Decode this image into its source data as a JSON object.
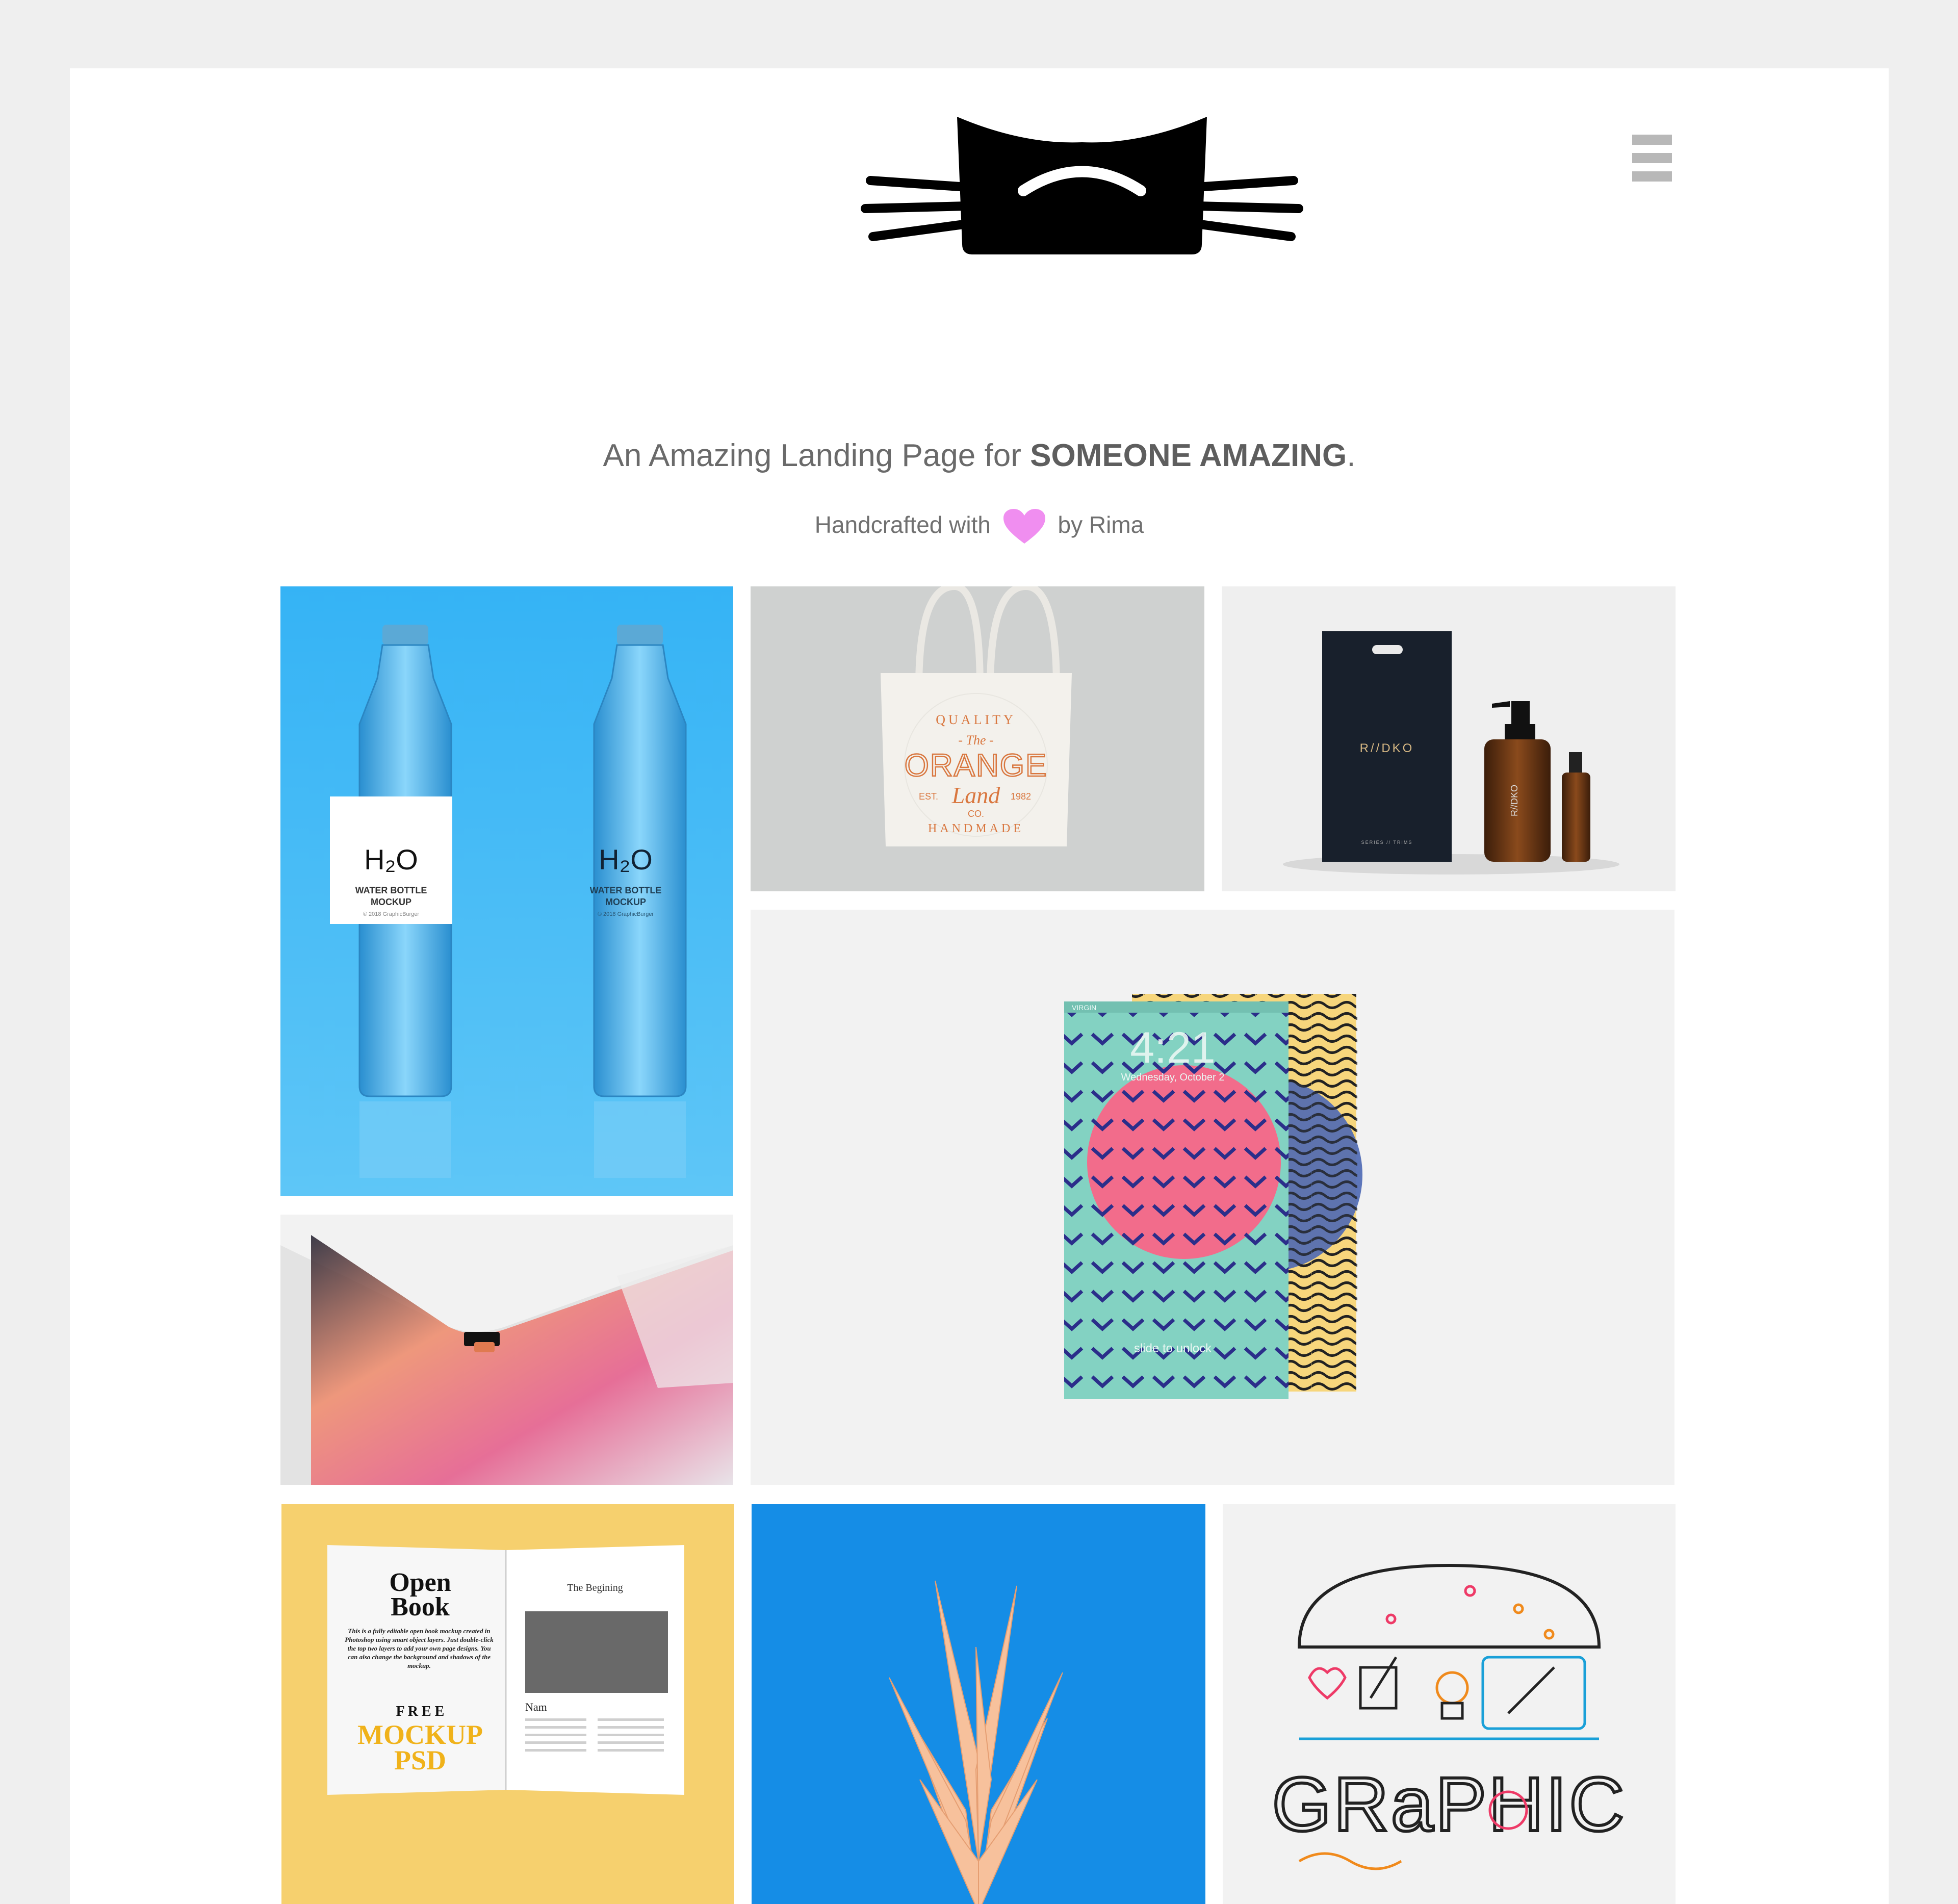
{
  "header": {
    "logo_name": "cat-logo",
    "menu_icon": "hamburger-menu-icon"
  },
  "hero": {
    "tagline_prefix": "An Amazing Landing Page for ",
    "tagline_bold": "SOMEONE AMAZING",
    "tagline_suffix": ".",
    "credit_prefix": "Handcrafted with",
    "credit_icon": "heart-icon",
    "credit_suffix": "by Rima",
    "heart_color": "#f08ef0"
  },
  "gallery": {
    "water_bottle": {
      "title": "H₂O",
      "line1": "WATER BOTTLE",
      "line2": "MOCKUP",
      "line3": "© 2018 GraphicBurger",
      "bg": "#3ab6f6"
    },
    "tote_bag": {
      "top_arc": "QUALITY",
      "the": "- The -",
      "brand": "ORANGE",
      "land": "Land",
      "est": "EST.",
      "year": "1982",
      "co": "CO.",
      "bottom_arc": "HANDMADE",
      "accent": "#d9773f"
    },
    "cosmetics": {
      "brand": "R//DKO",
      "sub": "SERIES // TRIMS",
      "bottle_text": "R//DKO"
    },
    "phone": {
      "time": "4:21",
      "date": "Wednesday, October 2",
      "carrier": "VIRGIN",
      "unlock": "slide to unlock"
    },
    "book": {
      "title1": "Open",
      "title2": "Book",
      "body": "This is a fully editable open book mockup created in Photoshop using smart object layers. Just double-click the top two layers to add your own page designs. You can also change the background and shadows of the mockup.",
      "free": "F R E E",
      "mockup": "MOCKUP",
      "psd": "PSD",
      "chapter": "The Begining",
      "name": "Nam"
    },
    "graphic": {
      "word": "GRaPHIC"
    }
  }
}
